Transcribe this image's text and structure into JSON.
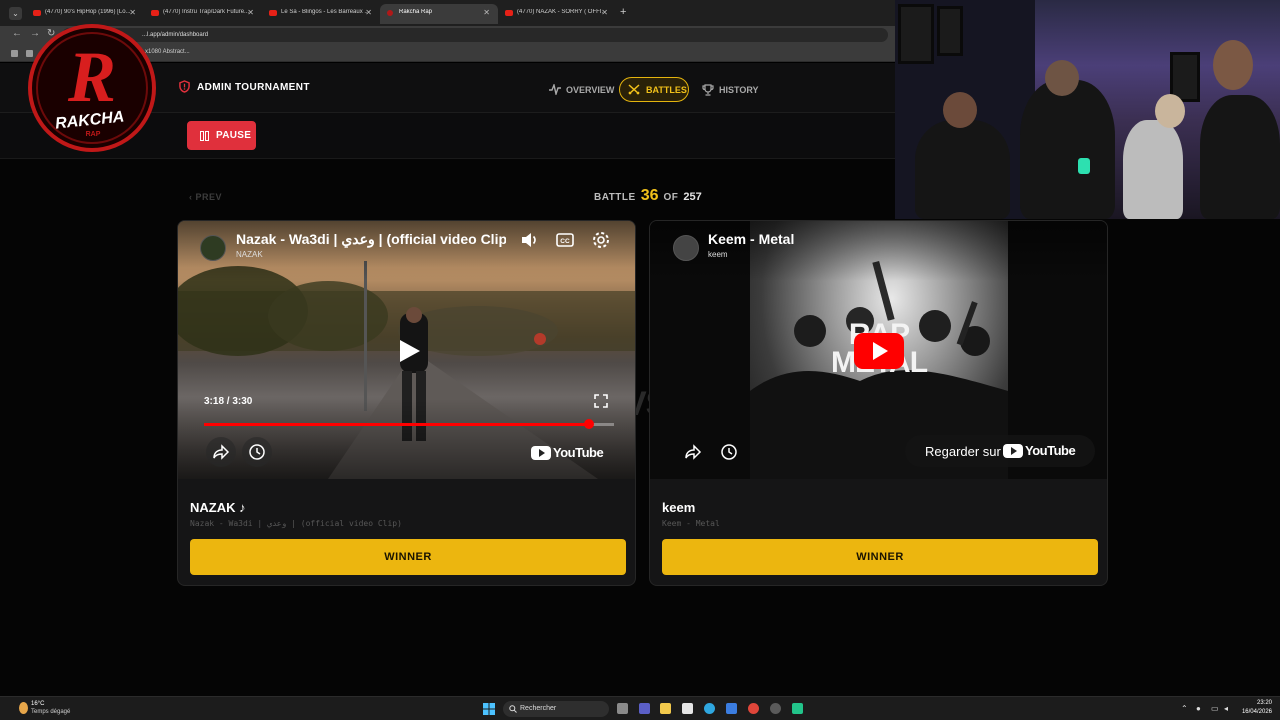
{
  "browser": {
    "tabs": [
      {
        "title": "(4770) 90's HipHop (1996) [Lo...",
        "active": false
      },
      {
        "title": "(4770) Instru Trap/Dark Future...",
        "active": false
      },
      {
        "title": "Le Sa - Blingos - Les Barreaux ...",
        "active": false
      },
      {
        "title": "Rakcha Rap",
        "active": true
      },
      {
        "title": "(4770) NAZAK - SORRY ( OFFI...",
        "active": false
      }
    ],
    "url": "...l.app/admin/dashboard",
    "bookmark": "...x1080 Abstract..."
  },
  "header": {
    "title": "ADMIN TOURNAMENT",
    "tabs": [
      {
        "label": "OVERVIEW",
        "icon": "activity-icon"
      },
      {
        "label": "BATTLES",
        "icon": "swords-icon",
        "active": true
      },
      {
        "label": "HISTORY",
        "icon": "trophy-icon"
      }
    ]
  },
  "controls": {
    "pause_label": "PAUSE"
  },
  "battle": {
    "prev_label": "‹ PREV",
    "word": "BATTLE",
    "current": "36",
    "of_word": "OF",
    "total": "257",
    "vs": "VS"
  },
  "cards": [
    {
      "video_title": "Nazak - Wa3di | وعدي | (official video Clip)",
      "channel": "NAZAK",
      "time": "3:18 / 3:30",
      "progress": 0.94,
      "artist": "NAZAK ♪",
      "track": "Nazak - Wa3di | وعدي | (official video Clip)",
      "winner_label": "WINNER",
      "youtube_word": "YouTube"
    },
    {
      "video_title": "Keem - Metal",
      "channel": "keem",
      "thumb_text": "RAP METAL",
      "watch_on_label": "Regarder sur",
      "youtube_word": "YouTube",
      "artist": "keem",
      "track": "Keem - Metal",
      "winner_label": "WINNER"
    }
  ],
  "overlay": {
    "logo_text": "RAKCHA",
    "logo_sub": "RAP"
  },
  "taskbar": {
    "temp": "16°C",
    "weather": "Temps dégagé",
    "search_placeholder": "Rechercher",
    "time": "23:20",
    "date": "16/04/2026"
  },
  "colors": {
    "accent_yellow": "#ecb60f",
    "pause_red": "#e0303c",
    "youtube_red": "#ff0000"
  }
}
